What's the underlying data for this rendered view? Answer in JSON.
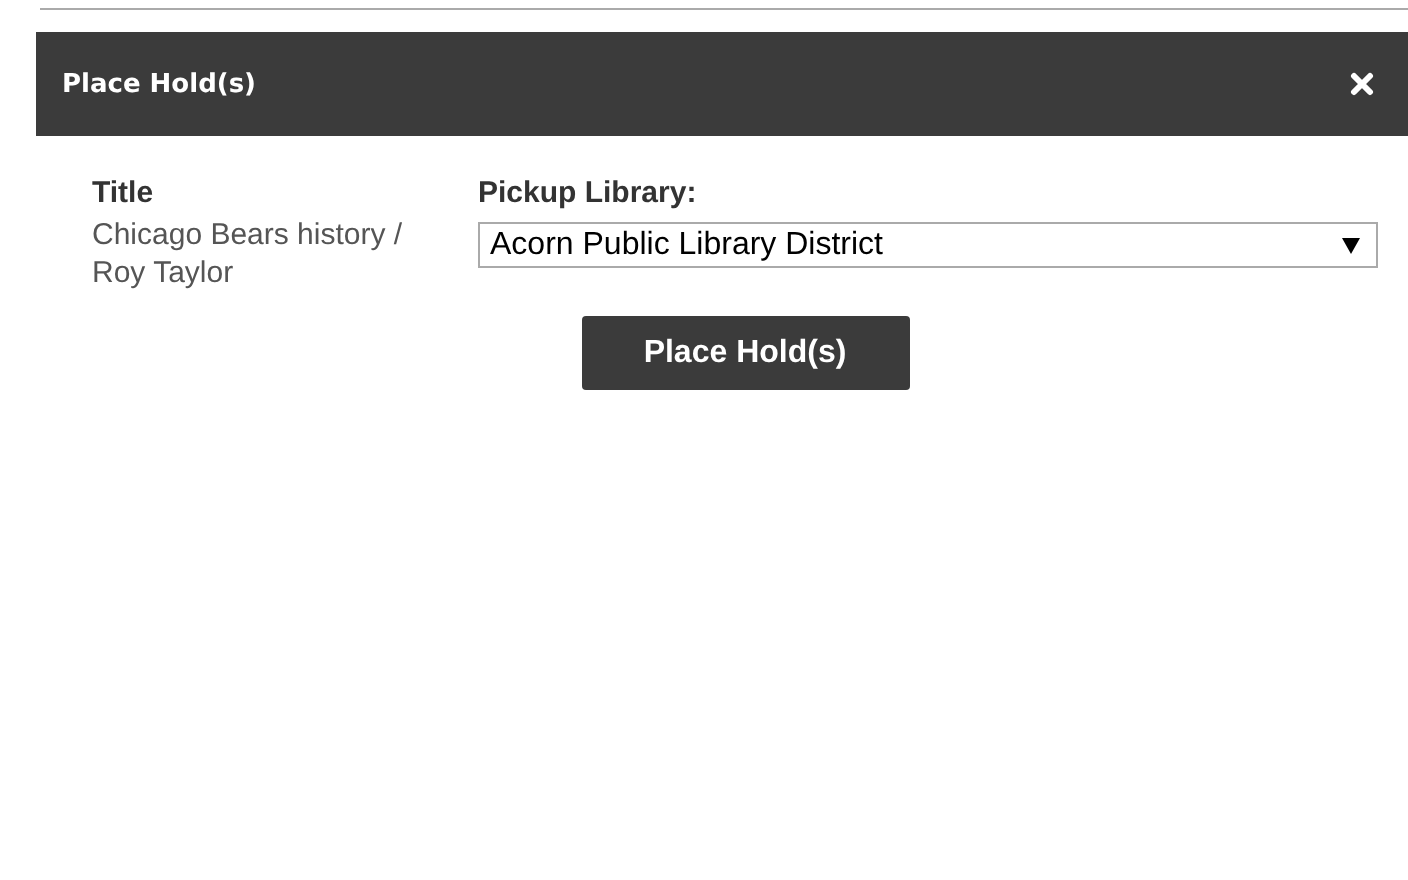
{
  "dialog": {
    "title": "Place Hold(s)"
  },
  "title_column": {
    "label": "Title",
    "value": "Chicago Bears history / Roy Taylor"
  },
  "pickup": {
    "label": "Pickup Library:",
    "value": "Acorn Public Library District"
  },
  "buttons": [
    "Place Hold(s)"
  ]
}
